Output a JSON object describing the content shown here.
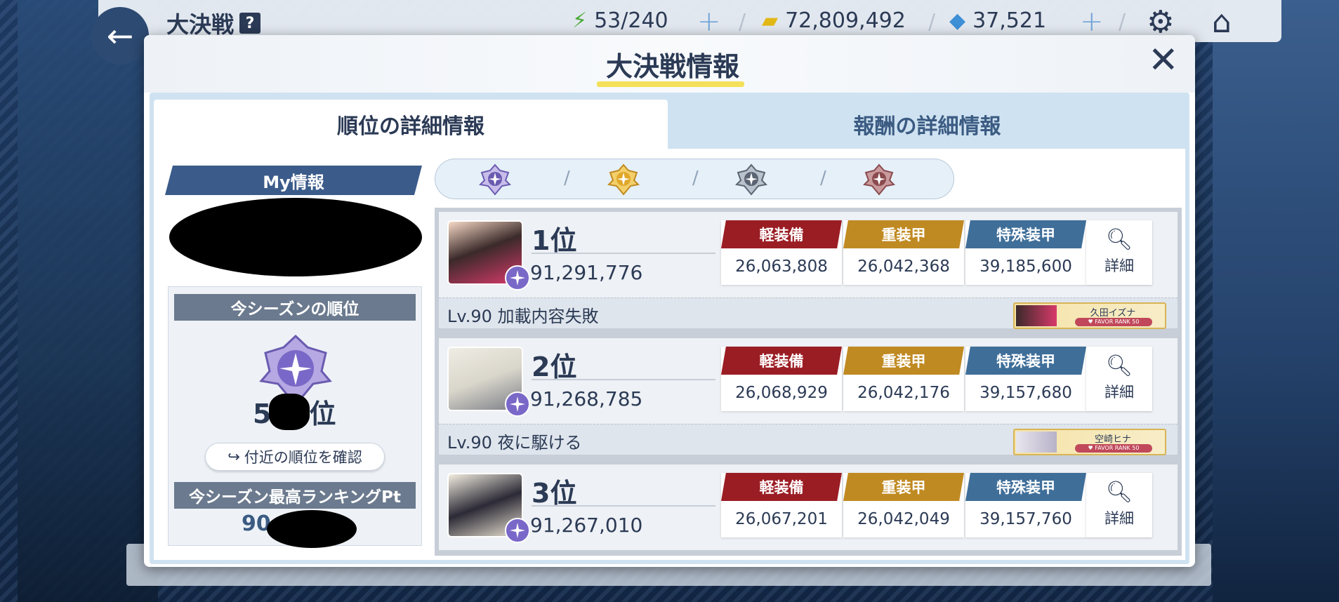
{
  "topbar": {
    "title": "大決戦",
    "help": "?",
    "ap": "53/240",
    "credits": "72,809,492",
    "gems": "37,521",
    "plus": "+",
    "sep": "/"
  },
  "modal": {
    "title": "大決戦情報",
    "close": "✕",
    "tabs": [
      {
        "label": "順位の詳細情報"
      },
      {
        "label": "報酬の詳細情報"
      }
    ]
  },
  "my_info": {
    "header": "My情報",
    "season_rank_header": "今シーズンの順位",
    "rank_prefix": "5",
    "rank_suffix": "位",
    "nearby_button": "付近の順位を確認",
    "best_header": "今シーズン最高ランキングPt",
    "best_prefix": "90"
  },
  "filter": {
    "items": [
      {
        "icon": "platinum-emblem-icon",
        "color": "#6a5bb0"
      },
      {
        "icon": "gold-emblem-icon",
        "color": "#e0a82a"
      },
      {
        "icon": "silver-emblem-icon",
        "color": "#5b6472"
      },
      {
        "icon": "bronze-emblem-icon",
        "color": "#8a4a4e"
      }
    ]
  },
  "armor_headers": {
    "light": "軽装備",
    "heavy": "重装甲",
    "special": "特殊装甲"
  },
  "detail_label": "詳細",
  "ranking": [
    {
      "rank": "1位",
      "score": "91,291,776",
      "light": "26,063,808",
      "heavy": "26,042,368",
      "special": "39,185,600",
      "team": "Lv.90  加載内容失敗",
      "favor_name": "久田イズナ",
      "favor_rank": "♥ FAVOR RANK 50"
    },
    {
      "rank": "2位",
      "score": "91,268,785",
      "light": "26,068,929",
      "heavy": "26,042,176",
      "special": "39,157,680",
      "team": "Lv.90  夜に駆ける",
      "favor_name": "空崎ヒナ",
      "favor_rank": "♥ FAVOR RANK 50"
    },
    {
      "rank": "3位",
      "score": "91,267,010",
      "light": "26,067,201",
      "heavy": "26,042,049",
      "special": "39,157,760"
    }
  ],
  "colors": {
    "light": "#9b1d24",
    "heavy": "#c08a22",
    "special": "#3f6e99"
  }
}
